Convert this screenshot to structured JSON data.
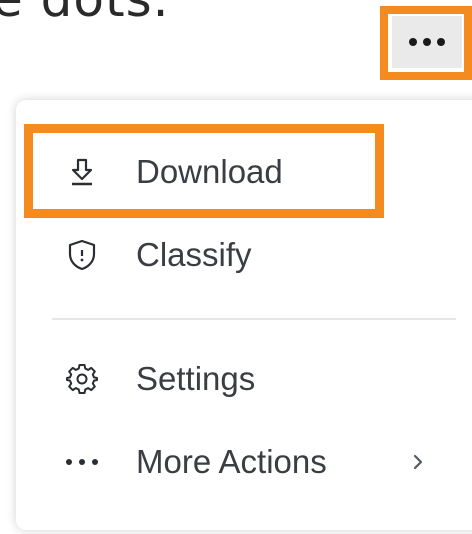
{
  "caption": {
    "text": "e dots."
  },
  "trigger": {
    "icon": "more-horizontal-icon",
    "highlight_color": "#f58b1f",
    "background": "#eaeaea"
  },
  "menu": {
    "items": [
      {
        "label": "Download",
        "icon": "download-icon",
        "highlighted": true
      },
      {
        "label": "Classify",
        "icon": "shield-icon",
        "highlighted": false
      },
      {
        "label": "Settings",
        "icon": "gear-icon",
        "highlighted": false
      },
      {
        "label": "More Actions",
        "icon": "more-horizontal-icon",
        "highlighted": false,
        "submenu_icon": "chevron-right-icon"
      }
    ]
  },
  "colors": {
    "highlight": "#f58b1f",
    "text": "#3a3d42",
    "divider": "#e6e6e6"
  }
}
